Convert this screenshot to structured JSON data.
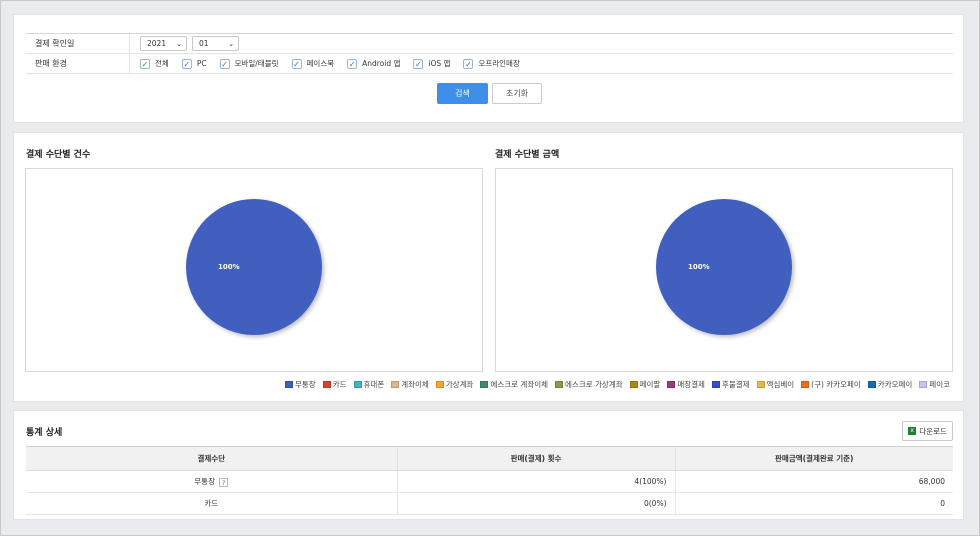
{
  "filter": {
    "date_label": "결제 확인일",
    "year": "2021",
    "month": "01",
    "env_label": "판매 환경",
    "envs": [
      "전체",
      "PC",
      "모바일/태블릿",
      "페이스북",
      "Android 앱",
      "iOS 앱",
      "오프라인매장"
    ]
  },
  "buttons": {
    "search": "검색",
    "reset": "초기화",
    "download": "다운로드"
  },
  "charts": {
    "count_title": "결제 수단별 건수",
    "amount_title": "결제 수단별 금액"
  },
  "chart_data": [
    {
      "type": "pie",
      "title": "결제 수단별 건수",
      "categories": [
        "무통장"
      ],
      "values": [
        100
      ],
      "labels": [
        "100%"
      ]
    },
    {
      "type": "pie",
      "title": "결제 수단별 금액",
      "categories": [
        "무통장"
      ],
      "values": [
        100
      ],
      "labels": [
        "100%"
      ]
    }
  ],
  "legend": [
    {
      "label": "무통장",
      "color": "#3f5ebf"
    },
    {
      "label": "카드",
      "color": "#d9432b"
    },
    {
      "label": "휴대폰",
      "color": "#3fb2c7"
    },
    {
      "label": "계좌이체",
      "color": "#d9b98c"
    },
    {
      "label": "가상계좌",
      "color": "#f0a830"
    },
    {
      "label": "에스크로 계좌이체",
      "color": "#3f8a6a"
    },
    {
      "label": "에스크로 가상계좌",
      "color": "#8a9a4a"
    },
    {
      "label": "페이팔",
      "color": "#a88a1a"
    },
    {
      "label": "매장결제",
      "color": "#9a3a7a"
    },
    {
      "label": "후불결제",
      "color": "#3a4acf"
    },
    {
      "label": "엑심베이",
      "color": "#e9b84a"
    },
    {
      "label": "(구) 카카오페이",
      "color": "#f06a1a"
    },
    {
      "label": "카카오페이",
      "color": "#1a6ab0"
    },
    {
      "label": "페이코",
      "color": "#cdc0ef"
    }
  ],
  "stats": {
    "title": "통계 상세",
    "headers": [
      "결제수단",
      "판매(결제) 횟수",
      "판매금액(결제완료 기준)"
    ],
    "rows": [
      {
        "method": "무통장",
        "count": "4(100%)",
        "amount": "68,000",
        "help": "?"
      },
      {
        "method": "카드",
        "count": "0(0%)",
        "amount": "0"
      }
    ]
  }
}
